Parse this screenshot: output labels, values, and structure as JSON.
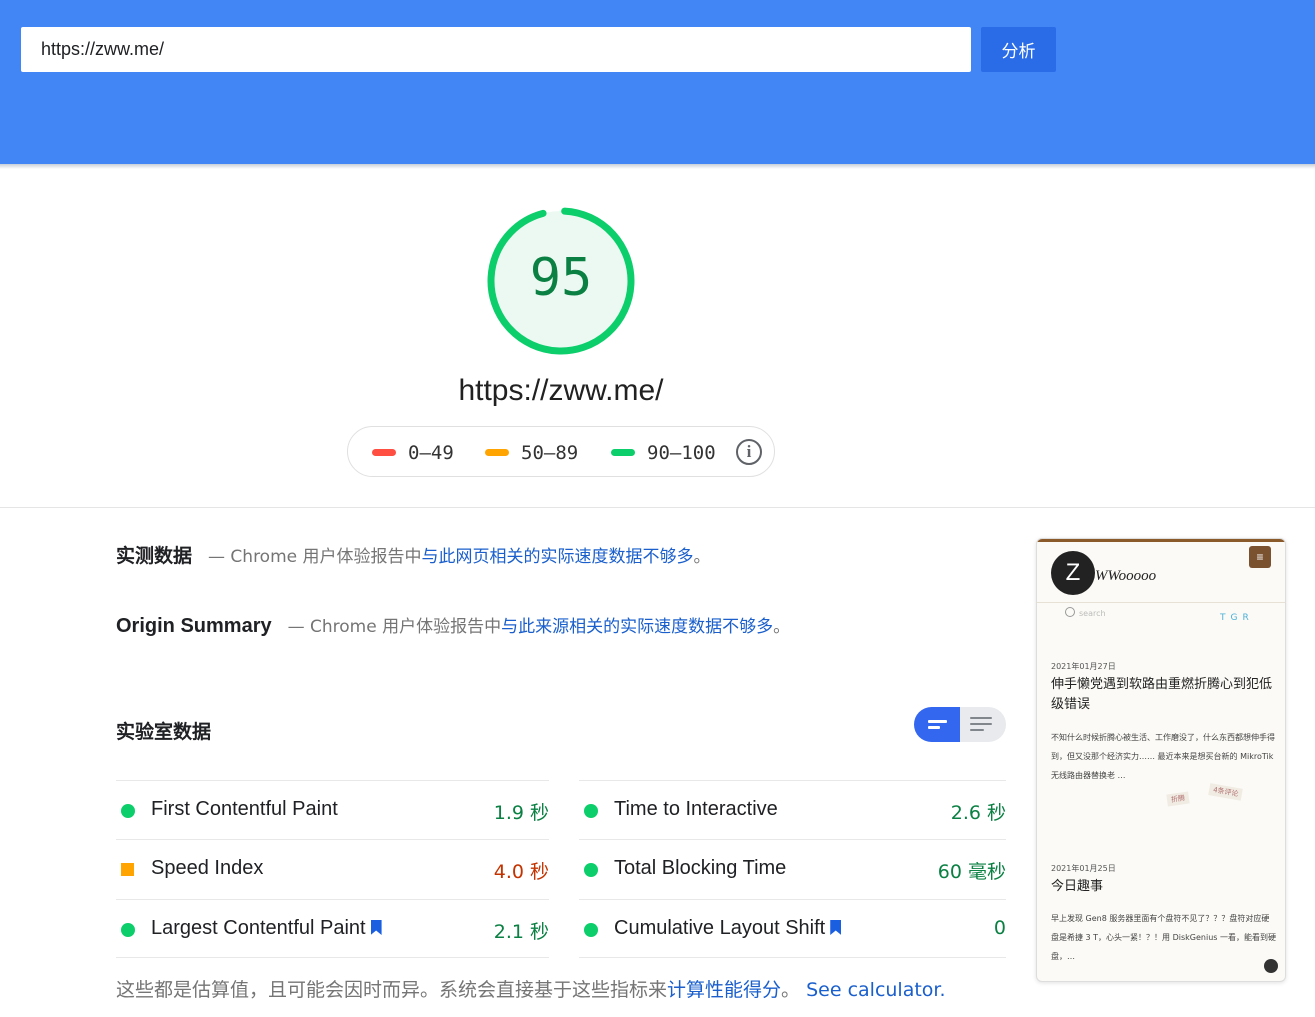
{
  "header": {
    "url_value": "https://zww.me/",
    "analyze_label": "分析"
  },
  "score": {
    "value": "95",
    "fraction": 0.95,
    "ring_color": "#0cce6b",
    "value_color": "#0a8043",
    "final_url": "https://zww.me/"
  },
  "legend": {
    "ranges": [
      {
        "label": "0–49",
        "color": "#ff4e42"
      },
      {
        "label": "50–89",
        "color": "#ffa400"
      },
      {
        "label": "90–100",
        "color": "#0cce6b"
      }
    ],
    "info_icon": "i"
  },
  "field_data": {
    "title": "实测数据",
    "desc_prefix": "— Chrome 用户体验报告中",
    "desc_link": "与此网页相关的实际速度数据不够多",
    "desc_suffix": "。"
  },
  "origin_summary": {
    "title": "Origin Summary",
    "desc_prefix": "— Chrome 用户体验报告中",
    "desc_link": "与此来源相关的实际速度数据不够多",
    "desc_suffix": "。"
  },
  "lab_data": {
    "title": "实验室数据",
    "metrics": [
      {
        "label": "First Contentful Paint",
        "value": "1.9 秒",
        "status": "pass",
        "color": "#0a8043"
      },
      {
        "label": "Time to Interactive",
        "value": "2.6 秒",
        "status": "pass",
        "color": "#0a8043"
      },
      {
        "label": "Speed Index",
        "value": "4.0 秒",
        "status": "average",
        "color": "#c33300"
      },
      {
        "label": "Total Blocking Time",
        "value": "60 毫秒",
        "status": "pass",
        "color": "#0a8043"
      },
      {
        "label": "Largest Contentful Paint",
        "value": "2.1 秒",
        "status": "pass",
        "color": "#0a8043"
      },
      {
        "label": "Cumulative Layout Shift",
        "value": "0",
        "status": "pass",
        "color": "#0a8043"
      }
    ]
  },
  "footnote": {
    "text": "这些都是估算值，且可能会因时而异。系统会直接基于这些指标来",
    "link": "计算性能得分",
    "suffix": "。",
    "calculator_link": "See calculator."
  },
  "thumbnail": {
    "logo_letter": "Z",
    "brand": "WWooooo",
    "menu_icon": "≡",
    "search_text": "search",
    "tgr": "TGR",
    "post1": {
      "date": "2021年01月27日",
      "title": "伸手懒党遇到软路由重燃折腾心到犯低级错误",
      "excerpt": "不知什么时候折腾心被生活、工作磨没了，什么东西都想伸手得到，但又没那个经济实力…… 最近本来是想买台新的 MikroTik 无线路由器替换老 …",
      "tag1": "折腾",
      "tag2": "4条评论"
    },
    "post2": {
      "date": "2021年01月25日",
      "title": "今日趣事",
      "excerpt": "早上发现 Gen8 服务器里面有个盘符不见了？？？盘符对应硬盘是希捷 3 T，心头一紧！？！用 DiskGenius 一看，能看到硬盘，…"
    }
  }
}
